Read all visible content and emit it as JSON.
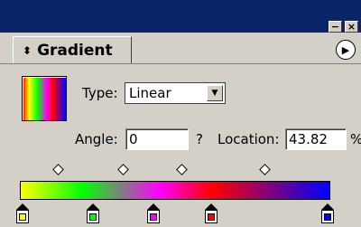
{
  "window": {
    "minimize_glyph": "−",
    "close_glyph": "×"
  },
  "tab": {
    "arrow": "⬍",
    "label": "Gradient",
    "menu_glyph": "▶"
  },
  "gradient": {
    "type_label": "Type:",
    "type_value": "Linear",
    "angle_label": "Angle:",
    "angle_value": "0",
    "angle_unit": "?",
    "location_label": "Location:",
    "location_value": "43.82",
    "location_unit": "%"
  },
  "stops": [
    {
      "color": "#ffff00"
    },
    {
      "color": "#00ff00"
    },
    {
      "color": "#ff00ff"
    },
    {
      "color": "#ff0000"
    },
    {
      "color": "#0000ff"
    }
  ],
  "colors": {
    "titlebar": "#0a246a",
    "panel": "#d4d0c8"
  }
}
